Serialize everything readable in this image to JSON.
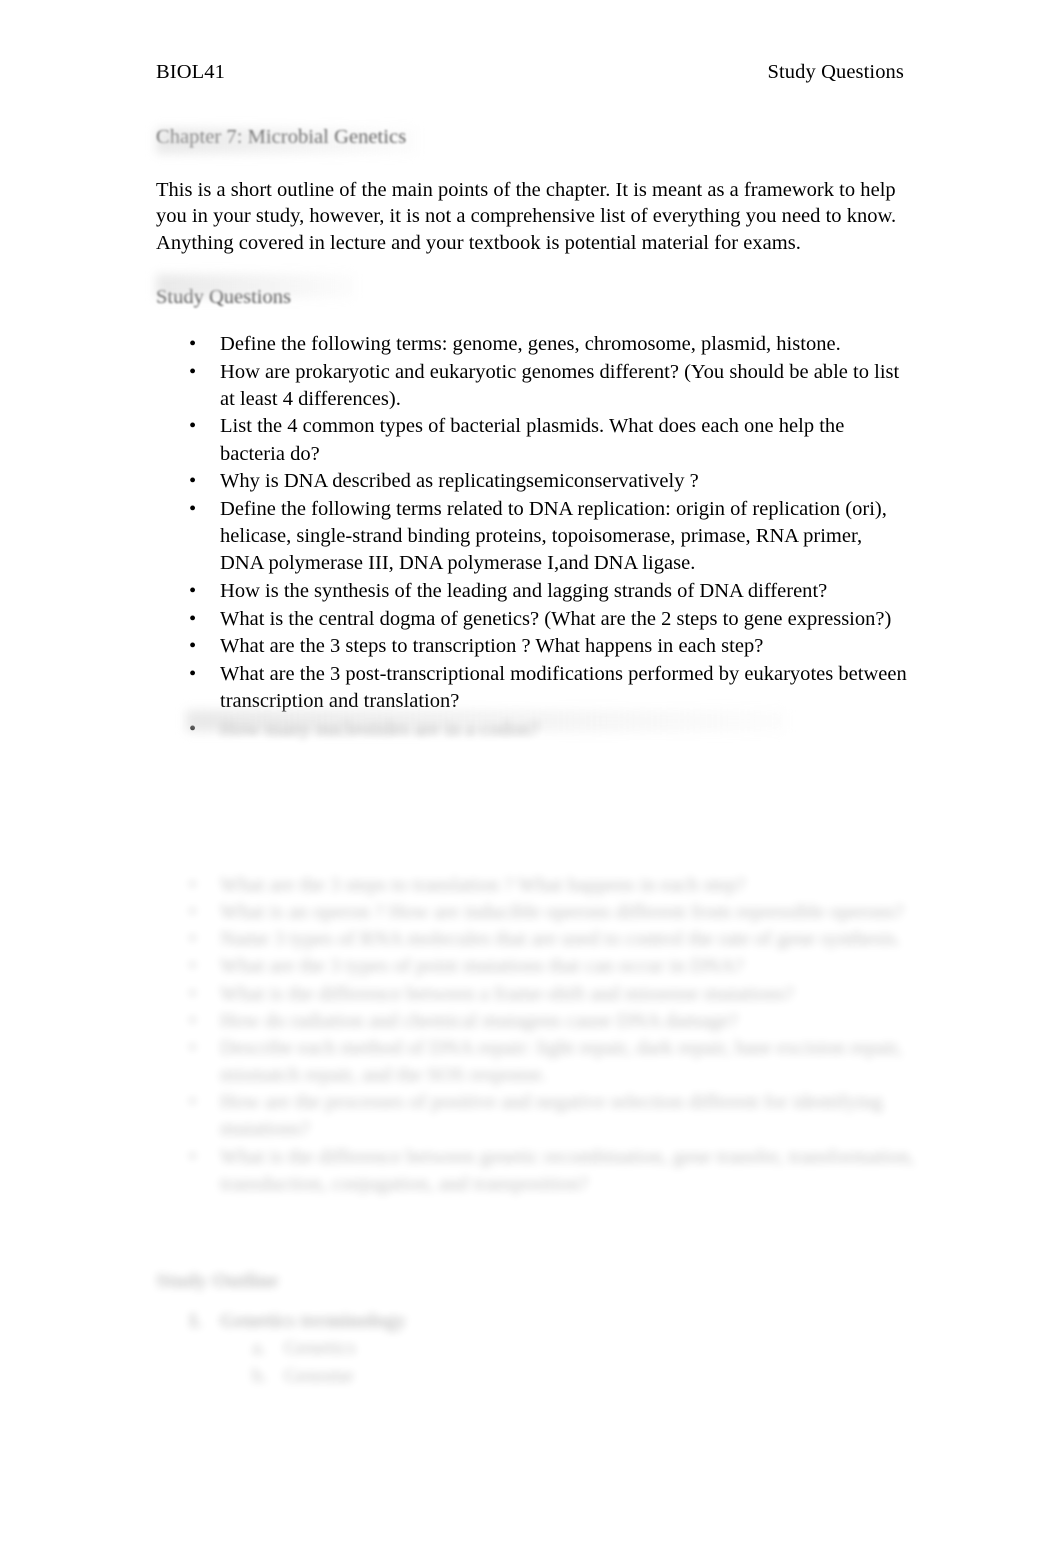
{
  "document": {
    "header": {
      "left": "BIOL41",
      "right": "Study Questions"
    },
    "chapter_title": "Chapter 7: Microbial Genetics",
    "intro_paragraph": "This is a short outline of the main points of the chapter. It is meant as a framework to help you in your study, however, it is not a comprehensive list of everything you need to know. Anything covered in lecture and your textbook is potential material for exams.",
    "study_questions_label": "Study Questions",
    "bullet_marker": "•",
    "questions": [
      "Define the following terms:  genome, genes, chromosome, plasmid, histone.",
      "How are prokaryotic  and eukaryotic  genomes different? (You should be able to list at least 4 differences).",
      "List the 4 common types of bacterial plasmids. What does each one help the bacteria do?",
      "Why is DNA described as replicatingsemiconservatively ?",
      "Define the following terms related to   DNA replication: origin of replication (ori), helicase, single-strand binding proteins, topoisomerase, primase, RNA primer, DNA polymerase III, DNA polymerase I,and  DNA ligase.",
      "How is the synthesis of the  leading  and  lagging strands of DNA different?",
      "What is the  central dogma  of genetics? (What are the 2 steps to gene expression?)",
      "What are the 3 steps to   transcription  ? What happens in each step?",
      "What are the 3 post-transcriptional modifications performed by eukaryotes between transcription and translation?",
      "How many nucleotides are in a  codon?"
    ],
    "obscured_questions": [
      "What are the 3 steps to  translation  ? What happens in each step?",
      "What is an operon ? How are inducible operons  different from  repressible operons?",
      "Name 3 types of RNA molecules that are used to control the rate of gene synthesis.",
      "What are the 3 types of  point mutations  that can occur in DNA?",
      "What is the difference between a   frame-shift  and  missense mutations?",
      "How do radiation and chemical mutagens cause DNA damage?",
      "Describe each method of DNA repair:  light repair, dark repair, base excision repair, mismatch repair, and the SOS response.",
      "How are the processes of  positive and negative selection different for identifying mutations?",
      "What is the difference between genetic  recombination, gene transfer, transformation, transduction,  conjugation, and transposition?"
    ],
    "outline_heading": "Study Outline",
    "outline_items": [
      {
        "number": "I.",
        "label": "Genetics terminology",
        "sub": [
          {
            "number": "a.",
            "label": "Genetics"
          },
          {
            "number": "b.",
            "label": "Genome"
          }
        ]
      }
    ]
  }
}
